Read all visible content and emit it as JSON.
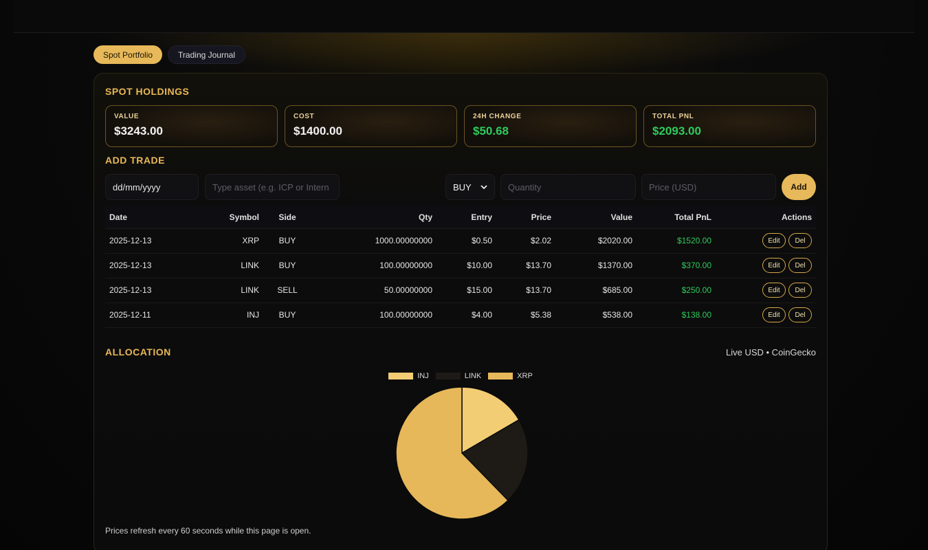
{
  "tabs": [
    {
      "label": "Spot Portfolio",
      "active": true
    },
    {
      "label": "Trading Journal",
      "active": false
    }
  ],
  "holdings": {
    "title": "SPOT HOLDINGS",
    "stats": [
      {
        "label": "VALUE",
        "value": "$3243.00"
      },
      {
        "label": "COST",
        "value": "$1400.00"
      },
      {
        "label": "24H CHANGE",
        "value": "$50.68"
      },
      {
        "label": "TOTAL PNL",
        "value": "$2093.00"
      }
    ]
  },
  "add_trade": {
    "title": "ADD TRADE",
    "date_value": "dd/mm/yyyy",
    "asset_placeholder": "Type asset (e.g. ICP or Intern",
    "side_value": "BUY",
    "qty_placeholder": "Quantity",
    "price_placeholder": "Price (USD)",
    "add_label": "Add"
  },
  "table": {
    "headers": [
      "Date",
      "Symbol",
      "Side",
      "Qty",
      "Entry",
      "Price",
      "Value",
      "Total PnL",
      "Actions"
    ],
    "rows": [
      {
        "date": "2025-12-13",
        "symbol": "XRP",
        "side": "BUY",
        "qty": "1000.00000000",
        "entry": "$0.50",
        "price": "$2.02",
        "value": "$2020.00",
        "pnl": "$1520.00"
      },
      {
        "date": "2025-12-13",
        "symbol": "LINK",
        "side": "BUY",
        "qty": "100.00000000",
        "entry": "$10.00",
        "price": "$13.70",
        "value": "$1370.00",
        "pnl": "$370.00"
      },
      {
        "date": "2025-12-13",
        "symbol": "LINK",
        "side": "SELL",
        "qty": "50.00000000",
        "entry": "$15.00",
        "price": "$13.70",
        "value": "$685.00",
        "pnl": "$250.00"
      },
      {
        "date": "2025-12-11",
        "symbol": "INJ",
        "side": "BUY",
        "qty": "100.00000000",
        "entry": "$4.00",
        "price": "$5.38",
        "value": "$538.00",
        "pnl": "$138.00"
      }
    ],
    "edit_label": "Edit",
    "del_label": "Del"
  },
  "allocation": {
    "title": "ALLOCATION",
    "source": "Live USD • CoinGecko",
    "footnote": "Prices refresh every 60 seconds while this page is open."
  },
  "colors": {
    "accent": "#e8b95a",
    "positive": "#2fcb5c",
    "inj": "#f3cd73",
    "link": "#1e1b16",
    "xrp": "#e6b85a"
  },
  "chart_data": {
    "type": "pie",
    "categories": [
      "INJ",
      "LINK",
      "XRP"
    ],
    "values": [
      538,
      685,
      2020
    ],
    "legend": "top"
  }
}
